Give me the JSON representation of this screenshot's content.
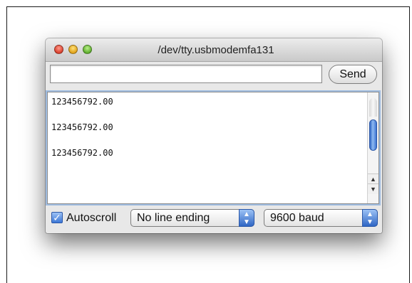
{
  "window": {
    "title": "/dev/tty.usbmodemfa131"
  },
  "toolbar": {
    "input_value": "",
    "send_label": "Send"
  },
  "output": {
    "lines": [
      "123456792.00",
      "123456792.00",
      "123456792.00"
    ]
  },
  "statusbar": {
    "autoscroll_label": "Autoscroll",
    "autoscroll_checked": true,
    "line_ending": "No line ending",
    "baud": "9600 baud"
  },
  "icons": {
    "close": "close-icon",
    "minimize": "minimize-icon",
    "zoom": "zoom-icon",
    "checkbox": "checkmark-icon",
    "select": "up-down-arrows-icon"
  },
  "colors": {
    "accent": "#3c77d6",
    "close": "#d9402c",
    "minimize": "#e0a21a",
    "zoom": "#5fae2e"
  }
}
